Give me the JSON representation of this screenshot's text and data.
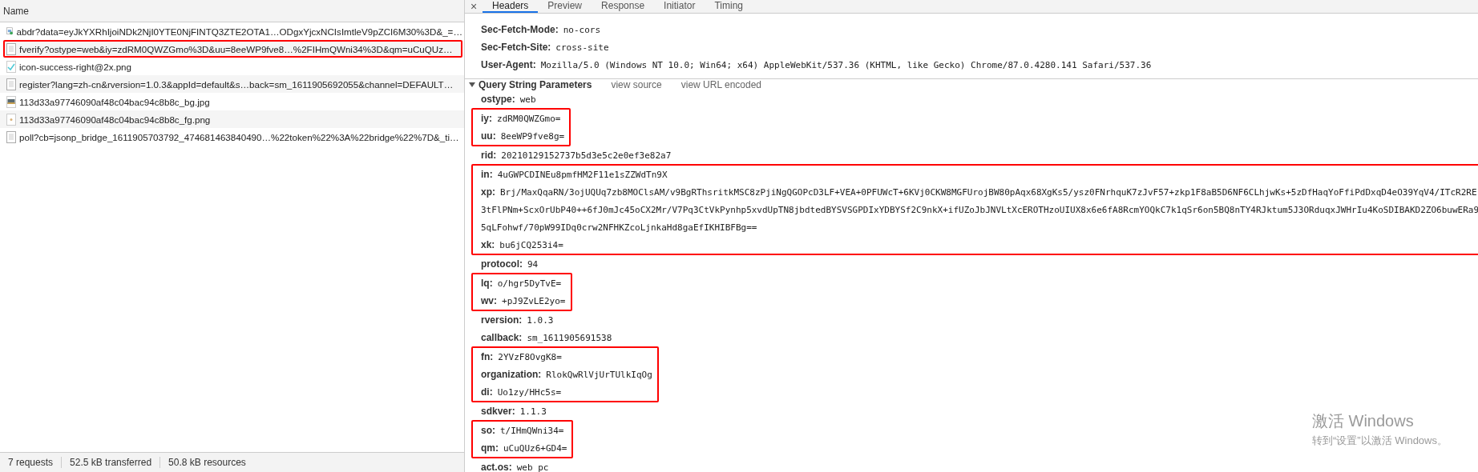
{
  "requests_panel": {
    "column_header": "Name",
    "requests": [
      {
        "name": "abdr?data=eyJkYXRhIjoiNDk2NjI0YTE0NjFINTQ3ZTE2OTA1…ODgxYjcxNCIsImtleV9pZCI6M30%3D&_=…",
        "kind": "script",
        "highlighted": false
      },
      {
        "name": "fverify?ostype=web&iy=zdRM0QWZGmo%3D&uu=8eeWP9fve8…%2FIHmQWni34%3D&qm=uCuQUz…",
        "kind": "document",
        "highlighted": true
      },
      {
        "name": "icon-success-right@2x.png",
        "kind": "check",
        "highlighted": false
      },
      {
        "name": "register?lang=zh-cn&rversion=1.0.3&appId=default&s…back=sm_1611905692055&channel=DEFAULT…",
        "kind": "document",
        "highlighted": false
      },
      {
        "name": "113d33a97746090af48c04bac94c8b8c_bg.jpg",
        "kind": "photo",
        "highlighted": false
      },
      {
        "name": "113d33a97746090af48c04bac94c8b8c_fg.png",
        "kind": "sprite",
        "highlighted": false
      },
      {
        "name": "poll?cb=jsonp_bridge_1611905703792_474681463840490…%22token%22%3A%22bridge%22%7D&_ti…",
        "kind": "document",
        "highlighted": false
      }
    ],
    "status_bar": [
      "7 requests",
      "52.5 kB transferred",
      "50.8 kB resources"
    ]
  },
  "detail_panel": {
    "close": "×",
    "tabs": [
      {
        "label": "Headers",
        "selected": true
      },
      {
        "label": "Preview",
        "selected": false
      },
      {
        "label": "Response",
        "selected": false
      },
      {
        "label": "Initiator",
        "selected": false
      },
      {
        "label": "Timing",
        "selected": false
      }
    ],
    "request_headers": [
      {
        "name": "Sec-Fetch-Mode:",
        "value": "no-cors"
      },
      {
        "name": "Sec-Fetch-Site:",
        "value": "cross-site"
      },
      {
        "name": "User-Agent:",
        "value": "Mozilla/5.0 (Windows NT 10.0; Win64; x64) AppleWebKit/537.36 (KHTML, like Gecko) Chrome/87.0.4280.141 Safari/537.36"
      }
    ],
    "query_section": {
      "title": "Query String Parameters",
      "expanded": true,
      "links": [
        "view source",
        "view URL encoded"
      ]
    },
    "param_groups": [
      {
        "highlighted": false,
        "params": [
          {
            "name": "ostype:",
            "value": "web"
          }
        ]
      },
      {
        "highlighted": true,
        "params": [
          {
            "name": "iy:",
            "value": "zdRM0QWZGmo="
          },
          {
            "name": "uu:",
            "value": "8eeWP9fve8g="
          }
        ]
      },
      {
        "highlighted": false,
        "params": [
          {
            "name": "rid:",
            "value": "20210129152737b5d3e5c2e0ef3e82a7"
          }
        ]
      },
      {
        "highlighted": true,
        "params": [
          {
            "name": "in:",
            "value": "4uGWPCDINEu8pmfHM2F11e1sZZWdTn9X"
          },
          {
            "name": "xp:",
            "value": "Brj/MaxQqaRN/3ojUQUq7zb8MOClsAM/v9BgRThsritkMSC8zPjiNgQGOPcD3LF+VEA+0PFUWcT+6KVj0CKW8MGFUrojBW80pAqx68XgKs5/ysz0FNrhquK7zJvF57+zkp1F8aB5D6NF6CLhjwKs+5zDfHaqYoFfiPdDxqD4eO39YqV4/ITcR2RE",
            "continuation_lines": [
              "3tFlPNm+ScxOrUbP40++6fJ0mJc45oCX2Mr/V7Pq3CtVkPynhp5xvdUpTN8jbdtedBYSVSGPDIxYDBYSf2C9nkX+ifUZoJbJNVLtXcEROTHzoUIUX8x6e6fA8RcmYOQkC7k1qSr6on5BQ8nTY4RJktum5J3ORduqxJWHrIu4KoSDIBAKD2ZO6buwERa9",
              "5qLFohwf/70pW99IDq0crw2NFHKZcoLjnkaHd8gaEfIKHIBFBg=="
            ]
          },
          {
            "name": "xk:",
            "value": "bu6jCQ253i4="
          }
        ]
      },
      {
        "highlighted": false,
        "params": [
          {
            "name": "protocol:",
            "value": "94"
          }
        ]
      },
      {
        "highlighted": true,
        "params": [
          {
            "name": "lq:",
            "value": "o/hgr5DyTvE="
          },
          {
            "name": "wv:",
            "value": "+pJ9ZvLE2yo="
          }
        ]
      },
      {
        "highlighted": false,
        "params": [
          {
            "name": "rversion:",
            "value": "1.0.3"
          },
          {
            "name": "callback:",
            "value": "sm_1611905691538"
          }
        ]
      },
      {
        "highlighted": true,
        "params": [
          {
            "name": "fn:",
            "value": "2YVzF8OvgK8="
          },
          {
            "name": "organization:",
            "value": "RlokQwRlVjUrTUlkIqOg"
          },
          {
            "name": "di:",
            "value": "Uo1zy/HHc5s="
          }
        ]
      },
      {
        "highlighted": false,
        "params": [
          {
            "name": "sdkver:",
            "value": "1.1.3"
          }
        ]
      },
      {
        "highlighted": true,
        "params": [
          {
            "name": "so:",
            "value": "t/IHmQWni34="
          },
          {
            "name": "qm:",
            "value": "uCuQUz6+GD4="
          }
        ]
      },
      {
        "highlighted": false,
        "params": [
          {
            "name": "act.os:",
            "value": "web_pc"
          }
        ]
      }
    ]
  },
  "os_notice": {
    "title": "激活 Windows",
    "subtitle": "转到“设置”以激活 Windows。"
  }
}
